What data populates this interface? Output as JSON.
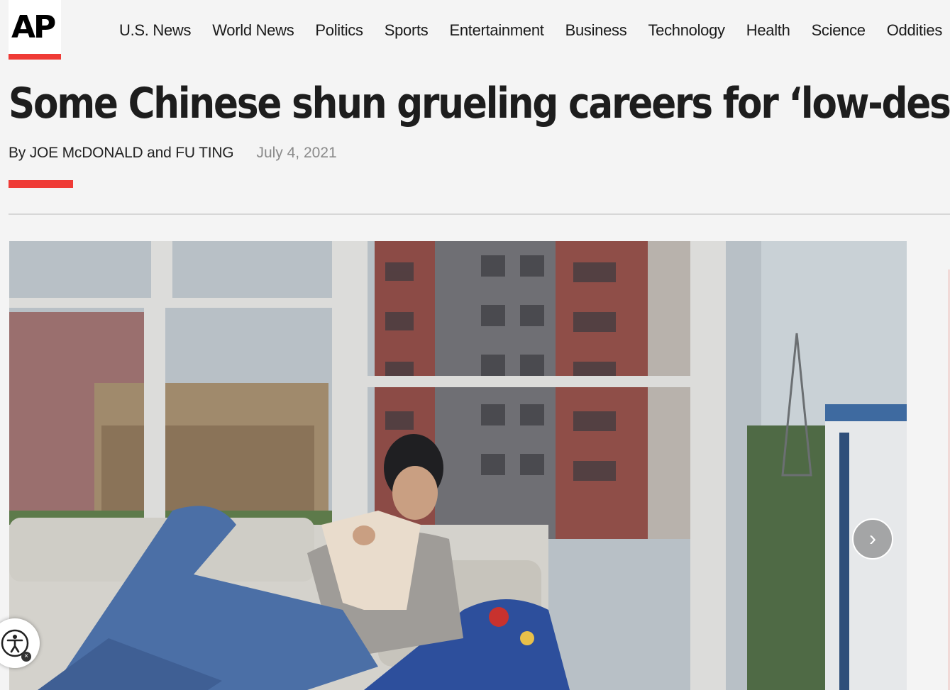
{
  "logo": {
    "text": "AP",
    "accent_color": "#ef3b36"
  },
  "nav": {
    "items": [
      {
        "label": "U.S. News"
      },
      {
        "label": "World News"
      },
      {
        "label": "Politics"
      },
      {
        "label": "Sports"
      },
      {
        "label": "Entertainment"
      },
      {
        "label": "Business"
      },
      {
        "label": "Technology"
      },
      {
        "label": "Health"
      },
      {
        "label": "Science"
      },
      {
        "label": "Oddities"
      }
    ]
  },
  "article": {
    "headline": "Some Chinese shun grueling careers for ‘low-desire life’",
    "byline": "By JOE McDONALD and FU TING",
    "date": "July 4, 2021"
  },
  "gallery": {
    "next_icon": "chevron-right-icon"
  },
  "accessibility": {
    "icon": "accessibility-person-icon",
    "close_icon": "close-icon"
  }
}
